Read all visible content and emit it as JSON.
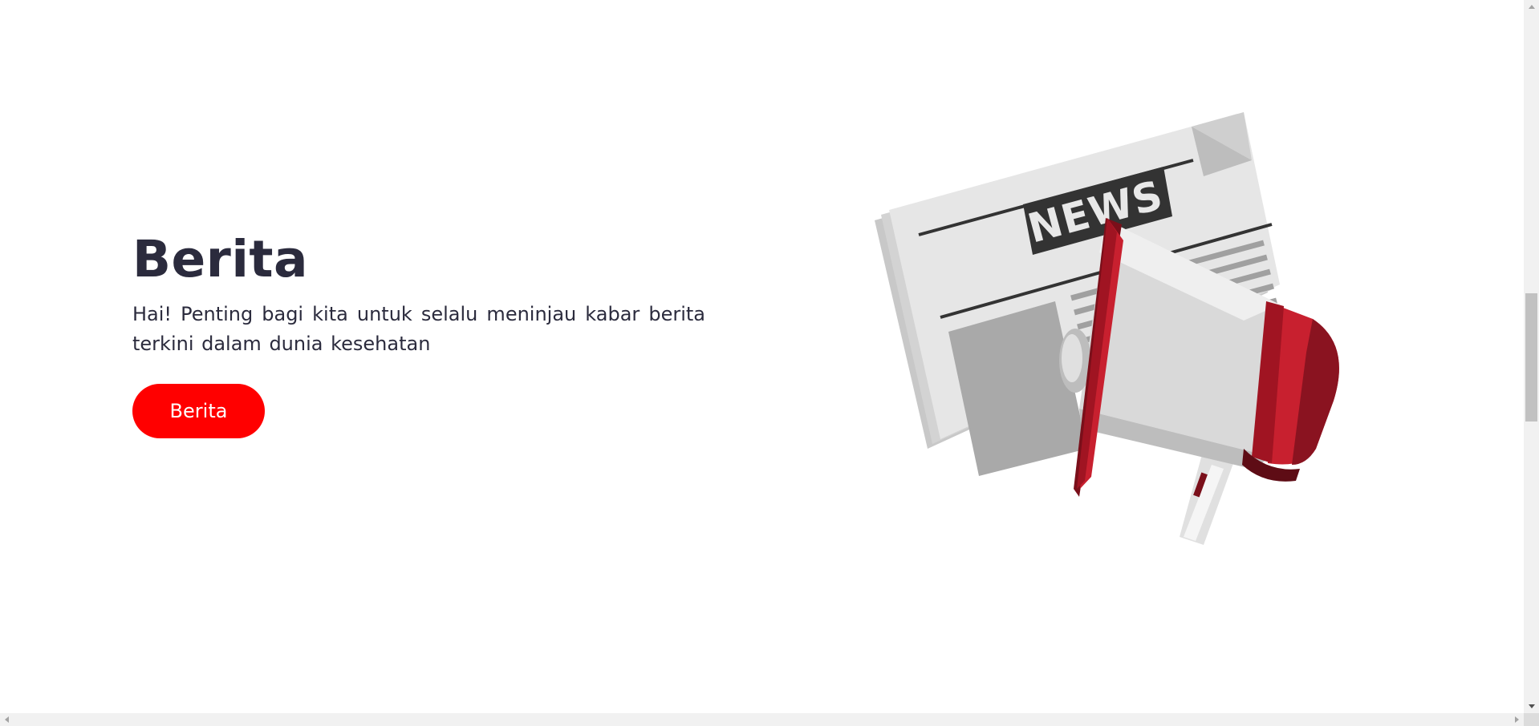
{
  "hero": {
    "title": "Berita",
    "description": "Hai! Penting bagi kita untuk selalu meninjau kabar berita terkini dalam dunia kesehatan",
    "button_label": "Berita"
  },
  "illustration": {
    "icon": "news-megaphone-illustration",
    "newspaper_headline": "NEWS"
  },
  "colors": {
    "accent": "#ff0000",
    "text": "#2b2b3d",
    "megaphone_red": "#c8202f",
    "megaphone_dark": "#7a0f1a",
    "paper_light": "#e8e8e8",
    "paper_mid": "#bdbdbd"
  }
}
